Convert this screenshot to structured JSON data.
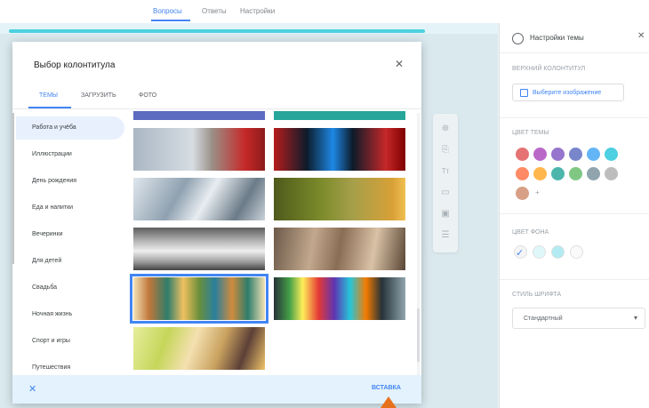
{
  "top_tabs": [
    {
      "label": "Вопросы",
      "active": true
    },
    {
      "label": "Ответы",
      "active": false
    },
    {
      "label": "Настройки",
      "active": false
    }
  ],
  "right_panel": {
    "title": "Настройки темы",
    "close_icon": "close-icon",
    "header_section_label": "ВЕРХНИЙ КОЛОНТИТУЛ",
    "choose_image_label": "Выберите изображение",
    "theme_color_label": "ЦВЕТ ТЕМЫ",
    "theme_colors": [
      "#e57373",
      "#ba68c8",
      "#9575cd",
      "#7986cb",
      "#64b5f6",
      "#4dd0e1",
      "#ff8a65",
      "#ffb74d",
      "#4db6ac",
      "#81c784",
      "#90a4ae",
      "#bdbdbd",
      "#d7a086"
    ],
    "add_color_symbol": "+",
    "bg_color_label": "ЦВЕТ ФОНА",
    "bg_colors": [
      "#f5f5f5",
      "#e0f7fa",
      "#b2ebf2",
      "#fafafa"
    ],
    "font_style_label": "СТИЛЬ ШРИФТА",
    "font_style_value": "Стандартный",
    "font_style_caret": "▾"
  },
  "dialog": {
    "title": "Выбор колонтитула",
    "close_symbol": "✕",
    "tabs": [
      {
        "label": "ТЕМЫ",
        "active": true
      },
      {
        "label": "ЗАГРУЗИТЬ",
        "active": false
      },
      {
        "label": "ФОТО",
        "active": false
      }
    ],
    "categories": [
      {
        "label": "Работа и учёба",
        "active": true
      },
      {
        "label": "Иллюстрации",
        "active": false
      },
      {
        "label": "День рождения",
        "active": false
      },
      {
        "label": "Еда и напитки",
        "active": false
      },
      {
        "label": "Вечеринки",
        "active": false
      },
      {
        "label": "Для детей",
        "active": false
      },
      {
        "label": "Свадьба",
        "active": false
      },
      {
        "label": "Ночная жизнь",
        "active": false
      },
      {
        "label": "Спорт и игры",
        "active": false
      },
      {
        "label": "Путешествия",
        "active": false
      }
    ],
    "footer_close_symbol": "✕",
    "insert_label": "ВСТАВКА"
  },
  "toolbar_icons": [
    "add-question-icon",
    "import-icon",
    "title-text-icon",
    "image-icon",
    "video-icon",
    "section-icon"
  ],
  "toolbar_glyphs": [
    "⊕",
    "⎘",
    "Tт",
    "▭",
    "▣",
    "☰"
  ]
}
